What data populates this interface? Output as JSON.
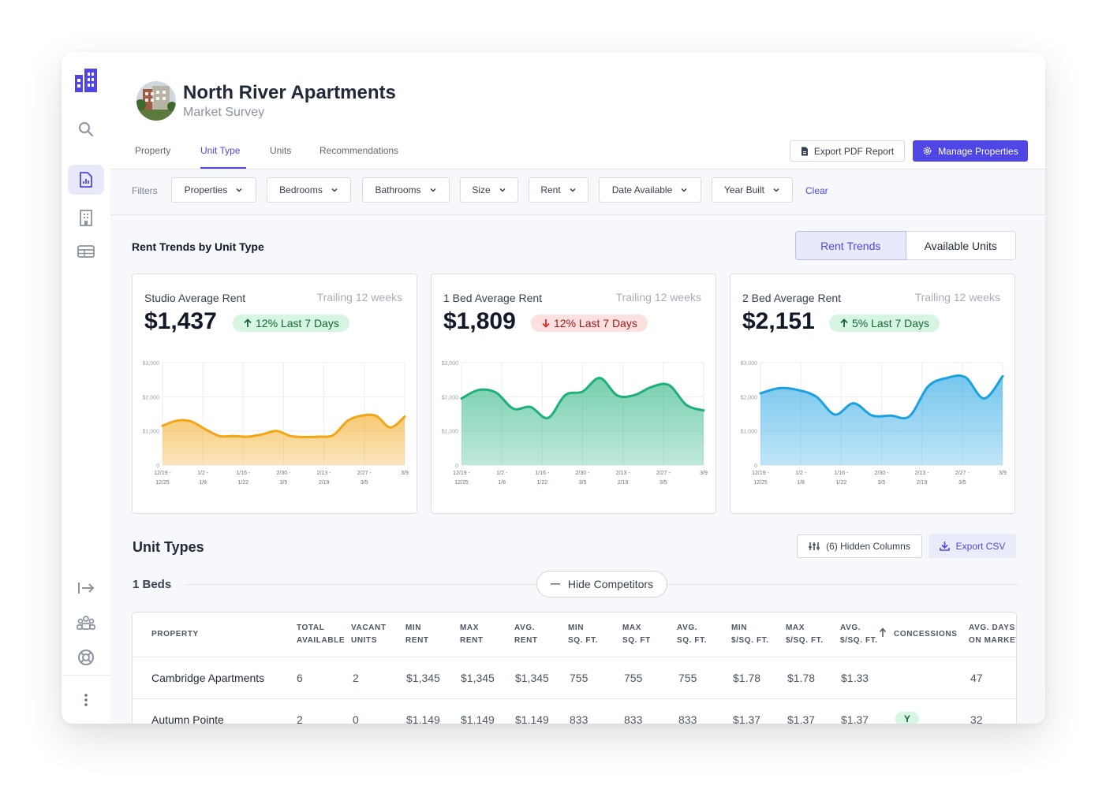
{
  "header": {
    "title": "North River Apartments",
    "subtitle": "Market Survey",
    "tabs": [
      {
        "label": "Property"
      },
      {
        "label": "Unit Type"
      },
      {
        "label": "Units"
      },
      {
        "label": "Recommendations"
      }
    ],
    "active_tab": "Unit Type",
    "export_pdf_label": "Export PDF Report",
    "manage_label": "Manage Properties"
  },
  "sidebar": {
    "icons": [
      "building-logo-icon",
      "search-icon",
      "report-icon",
      "building-icon",
      "table-icon",
      "logout-icon",
      "team-icon",
      "help-icon",
      "more-icon"
    ]
  },
  "filters": {
    "label": "Filters",
    "items": [
      "Properties",
      "Bedrooms",
      "Bathrooms",
      "Size",
      "Rent",
      "Date Available",
      "Year Built"
    ],
    "clear_label": "Clear"
  },
  "rent_trends": {
    "section_title": "Rent Trends by Unit Type",
    "toggle": [
      "Rent Trends",
      "Available Units"
    ],
    "toggle_selected": "Rent Trends",
    "cards": [
      {
        "title": "Studio Average Rent",
        "trailing": "Trailing 12 weeks",
        "value": "$1,437",
        "change": "12% Last 7 Days",
        "direction": "up"
      },
      {
        "title": "1 Bed Average Rent",
        "trailing": "Trailing 12 weeks",
        "value": "$1,809",
        "change": "12% Last 7 Days",
        "direction": "down"
      },
      {
        "title": "2 Bed Average Rent",
        "trailing": "Trailing 12 weeks",
        "value": "$2,151",
        "change": "5% Last 7 Days",
        "direction": "up"
      }
    ]
  },
  "chart_data": [
    {
      "type": "area",
      "title": "Studio Average Rent",
      "y_ticks": [
        "$3,000",
        "$2,000",
        "$1,000",
        "0"
      ],
      "x_ticks": [
        "12/19 - 12/25",
        "1/2 - 1/8",
        "1/16 - 1/22",
        "2/30 - 3/5",
        "2/13 - 2/19",
        "2/27 - 3/5",
        "3/9"
      ],
      "ylim": [
        0,
        3000
      ],
      "color": "#f2a516",
      "values": [
        1150,
        1300,
        1280,
        1050,
        850,
        850,
        830,
        900,
        1000,
        850,
        820,
        830,
        880,
        1300,
        1450,
        1440,
        1100,
        1420
      ]
    },
    {
      "type": "area",
      "title": "1 Bed Average Rent",
      "y_ticks": [
        "$3,000",
        "$2,000",
        "$1,000",
        "0"
      ],
      "x_ticks": [
        "12/19 - 12/25",
        "1/2 - 1/8",
        "1/16 - 1/22",
        "2/30 - 3/5",
        "2/13 - 2/19",
        "2/27 - 3/5",
        "3/9"
      ],
      "ylim": [
        0,
        3000
      ],
      "color": "#1db079",
      "values": [
        1950,
        2200,
        2120,
        1650,
        1700,
        1380,
        2050,
        2150,
        2550,
        2040,
        2050,
        2290,
        2340,
        1760,
        1600
      ]
    },
    {
      "type": "area",
      "title": "2 Bed Average Rent",
      "y_ticks": [
        "$3,000",
        "$2,000",
        "$1,000",
        "0"
      ],
      "x_ticks": [
        "12/19 - 12/25",
        "1/2 - 1/8",
        "1/16 - 1/22",
        "2/30 - 3/5",
        "2/13 - 2/19",
        "2/27 - 3/5",
        "3/9"
      ],
      "ylim": [
        0,
        3000
      ],
      "color": "#1ba1e2",
      "values": [
        2100,
        2250,
        2200,
        2000,
        1480,
        1810,
        1450,
        1450,
        1430,
        2300,
        2550,
        2570,
        1950,
        2600
      ]
    }
  ],
  "unit_types": {
    "title": "Unit Types",
    "hidden_columns_label": "(6) Hidden Columns",
    "export_csv_label": "Export CSV",
    "group_label": "1 Beds",
    "hide_competitors_label": "Hide Competitors",
    "columns": [
      [
        "PROPERTY"
      ],
      [
        "TOTAL",
        "AVAILABLE"
      ],
      [
        "VACANT",
        "UNITS"
      ],
      [
        "MIN",
        "RENT"
      ],
      [
        "MAX",
        "RENT"
      ],
      [
        "AVG.",
        "RENT"
      ],
      [
        "MIN",
        "SQ. FT."
      ],
      [
        "MAX",
        "SQ. FT"
      ],
      [
        "AVG.",
        "SQ. FT."
      ],
      [
        "MIN",
        "$/SQ. FT."
      ],
      [
        "MAX",
        "$/SQ. FT."
      ],
      [
        "AVG.",
        "$/SQ. FT."
      ],
      [
        "CONCESSIONS"
      ],
      [
        "AVG. DAYS",
        "ON MARKET"
      ]
    ],
    "rows": [
      [
        "Cambridge Apartments",
        "6",
        "2",
        "$1,345",
        "$1,345",
        "$1,345",
        "755",
        "755",
        "755",
        "$1.78",
        "$1.78",
        "$1.33",
        "",
        "47"
      ],
      [
        "Autumn Pointe",
        "2",
        "0",
        "$1,149",
        "$1,149",
        "$1,149",
        "833",
        "833",
        "833",
        "$1.37",
        "$1.37",
        "$1.37",
        "Y",
        "32"
      ]
    ]
  }
}
